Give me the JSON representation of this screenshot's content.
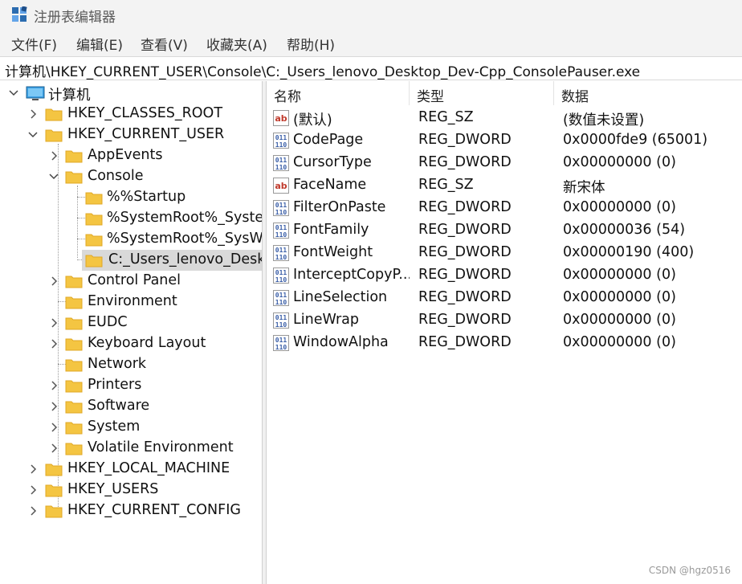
{
  "window": {
    "title": "注册表编辑器"
  },
  "menu": [
    "文件(F)",
    "编辑(E)",
    "查看(V)",
    "收藏夹(A)",
    "帮助(H)"
  ],
  "address": "计算机\\HKEY_CURRENT_USER\\Console\\C:_Users_lenovo_Desktop_Dev-Cpp_ConsolePauser.exe",
  "tree": {
    "computer": "计算机",
    "hkcr": "HKEY_CLASSES_ROOT",
    "hkcu": "HKEY_CURRENT_USER",
    "appevents": "AppEvents",
    "console": "Console",
    "startup": "%%Startup",
    "systemroot1": "%SystemRoot%_System",
    "systemroot2": "%SystemRoot%_SysWO",
    "selected_key": "C:_Users_lenovo_Deskt",
    "control_panel": "Control Panel",
    "environment": "Environment",
    "eudc": "EUDC",
    "keyboard_layout": "Keyboard Layout",
    "network": "Network",
    "printers": "Printers",
    "software": "Software",
    "system": "System",
    "volatile_environment": "Volatile Environment",
    "hklm": "HKEY_LOCAL_MACHINE",
    "hku": "HKEY_USERS",
    "hkcc": "HKEY_CURRENT_CONFIG"
  },
  "columns": {
    "name": "名称",
    "type": "类型",
    "data": "数据"
  },
  "values": [
    {
      "icon": "string-value-icon",
      "name": "(默认)",
      "type": "REG_SZ",
      "data": "(数值未设置)"
    },
    {
      "icon": "dword-value-icon",
      "name": "CodePage",
      "type": "REG_DWORD",
      "data": "0x0000fde9 (65001)"
    },
    {
      "icon": "dword-value-icon",
      "name": "CursorType",
      "type": "REG_DWORD",
      "data": "0x00000000 (0)"
    },
    {
      "icon": "string-value-icon",
      "name": "FaceName",
      "type": "REG_SZ",
      "data": "新宋体"
    },
    {
      "icon": "dword-value-icon",
      "name": "FilterOnPaste",
      "type": "REG_DWORD",
      "data": "0x00000000 (0)"
    },
    {
      "icon": "dword-value-icon",
      "name": "FontFamily",
      "type": "REG_DWORD",
      "data": "0x00000036 (54)"
    },
    {
      "icon": "dword-value-icon",
      "name": "FontWeight",
      "type": "REG_DWORD",
      "data": "0x00000190 (400)"
    },
    {
      "icon": "dword-value-icon",
      "name": "InterceptCopyP...",
      "type": "REG_DWORD",
      "data": "0x00000000 (0)"
    },
    {
      "icon": "dword-value-icon",
      "name": "LineSelection",
      "type": "REG_DWORD",
      "data": "0x00000000 (0)"
    },
    {
      "icon": "dword-value-icon",
      "name": "LineWrap",
      "type": "REG_DWORD",
      "data": "0x00000000 (0)"
    },
    {
      "icon": "dword-value-icon",
      "name": "WindowAlpha",
      "type": "REG_DWORD",
      "data": "0x00000000 (0)"
    }
  ],
  "watermark": "CSDN @hgz0516",
  "colors": {
    "folder": "#f4c542",
    "folder_dark": "#e0a825",
    "dword_icon": "#3b5fa8",
    "string_icon": "#c0392b",
    "selection": "#d9d9d9"
  }
}
